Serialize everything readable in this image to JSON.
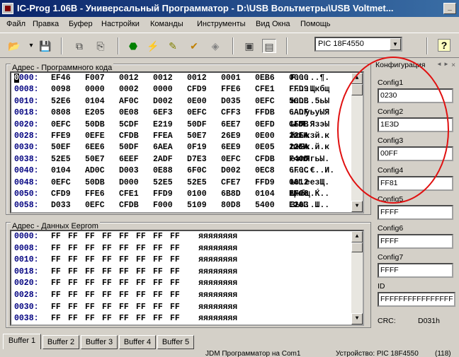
{
  "window": {
    "title": "IC-Prog 1.06B - Универсальный Программатор - D:\\USB Вольтметры\\USB Voltmet...",
    "min_glyph": "_"
  },
  "menu": [
    "Файл",
    "Правка",
    "Буфер",
    "Настройки",
    "Команды",
    "Инструменты",
    "Вид Окна",
    "Помощь"
  ],
  "toolbar": {
    "device": "PIC 18F4550",
    "dropdown_glyph": "▼"
  },
  "program_memory": {
    "title": "Адрес - Программного кода",
    "rows": [
      {
        "addr": "0000:",
        "w": [
          "EF46",
          "F007",
          "0012",
          "0012",
          "0012",
          "0001",
          "0EB6",
          "0000"
        ],
        "ascii": "F.....¶."
      },
      {
        "addr": "0008:",
        "w": [
          "0098",
          "0000",
          "0002",
          "0000",
          "CFD9",
          "FFE6",
          "CFE1",
          "FFD9"
        ],
        "ascii": "□...Щкбщ"
      },
      {
        "addr": "0010:",
        "w": [
          "52E6",
          "0104",
          "AF0C",
          "D002",
          "0E00",
          "D035",
          "0EFC",
          "50DB"
        ],
        "ascii": "ж....5ьЫ"
      },
      {
        "addr": "0018:",
        "w": [
          "0808",
          "E205",
          "0E08",
          "6EF3",
          "0EFC",
          "CFF3",
          "FFDB",
          "6ADF"
        ],
        "ascii": "...уьуЫЯ"
      },
      {
        "addr": "0020:",
        "w": [
          "0EFC",
          "50DB",
          "5CDF",
          "E219",
          "50DF",
          "6EE7",
          "0EFD",
          "CFDB"
        ],
        "ascii": "ьЫЯ.ЯзэЫ"
      },
      {
        "addr": "0028:",
        "w": [
          "FFE9",
          "0EFE",
          "CFDB",
          "FFEA",
          "50E7",
          "26E9",
          "0E00",
          "22EA"
        ],
        "ascii": "йюЫкзй.к"
      },
      {
        "addr": "0030:",
        "w": [
          "50EF",
          "6EE6",
          "50DF",
          "6AEA",
          "0F19",
          "6EE9",
          "0E05",
          "22EA"
        ],
        "ascii": "пжЯк.й.к"
      },
      {
        "addr": "0038:",
        "w": [
          "52E5",
          "50E7",
          "6EEF",
          "2ADF",
          "D7E3",
          "0EFC",
          "CFDB",
          "F40D"
        ],
        "ascii": "езпЯгьЫ."
      },
      {
        "addr": "0040:",
        "w": [
          "0104",
          "AD0C",
          "D003",
          "0E88",
          "6F0C",
          "D002",
          "0EC8",
          "6F0C"
        ],
        "ascii": "....€..И."
      },
      {
        "addr": "0048:",
        "w": [
          "0EFC",
          "50DB",
          "D000",
          "52E5",
          "52E5",
          "CFE7",
          "FFD9",
          "0012"
        ],
        "ascii": "ьЫ.eeзЩ."
      },
      {
        "addr": "0050:",
        "w": [
          "CFD9",
          "FFE6",
          "CFE1",
          "FFD9",
          "0100",
          "6B8D",
          "0104",
          "BF08"
        ],
        "ascii": "Щжбщ.Ќ.."
      },
      {
        "addr": "0058:",
        "w": [
          "D033",
          "0EFC",
          "CFDB",
          "F000",
          "5109",
          "80D8",
          "5400",
          "E203"
        ],
        "ascii": "3ьЫ..Ш.."
      }
    ]
  },
  "eeprom": {
    "title": "Адрес - Данных Eeprom",
    "rows": [
      {
        "addr": "0000:",
        "b": [
          "FF",
          "FF",
          "FF",
          "FF",
          "FF",
          "FF",
          "FF",
          "FF"
        ],
        "ascii": "яяяяяяяя"
      },
      {
        "addr": "0008:",
        "b": [
          "FF",
          "FF",
          "FF",
          "FF",
          "FF",
          "FF",
          "FF",
          "FF"
        ],
        "ascii": "яяяяяяяя"
      },
      {
        "addr": "0010:",
        "b": [
          "FF",
          "FF",
          "FF",
          "FF",
          "FF",
          "FF",
          "FF",
          "FF"
        ],
        "ascii": "яяяяяяяя"
      },
      {
        "addr": "0018:",
        "b": [
          "FF",
          "FF",
          "FF",
          "FF",
          "FF",
          "FF",
          "FF",
          "FF"
        ],
        "ascii": "яяяяяяяя"
      },
      {
        "addr": "0020:",
        "b": [
          "FF",
          "FF",
          "FF",
          "FF",
          "FF",
          "FF",
          "FF",
          "FF"
        ],
        "ascii": "яяяяяяяя"
      },
      {
        "addr": "0028:",
        "b": [
          "FF",
          "FF",
          "FF",
          "FF",
          "FF",
          "FF",
          "FF",
          "FF"
        ],
        "ascii": "яяяяяяяя"
      },
      {
        "addr": "0030:",
        "b": [
          "FF",
          "FF",
          "FF",
          "FF",
          "FF",
          "FF",
          "FF",
          "FF"
        ],
        "ascii": "яяяяяяяя"
      },
      {
        "addr": "0038:",
        "b": [
          "FF",
          "FF",
          "FF",
          "FF",
          "FF",
          "FF",
          "FF",
          "FF"
        ],
        "ascii": "яяяяяяяя"
      }
    ]
  },
  "config_panel": {
    "title": "Конфигурация",
    "nav": [
      "◄",
      "►",
      "×"
    ],
    "fields": [
      {
        "label": "Config1",
        "value": "0230"
      },
      {
        "label": "Config2",
        "value": "1E3D"
      },
      {
        "label": "Config3",
        "value": "00FF"
      },
      {
        "label": "Config4",
        "value": "FF81"
      },
      {
        "label": "Config5",
        "value": "FFFF"
      },
      {
        "label": "Config6",
        "value": "FFFF"
      },
      {
        "label": "Config7",
        "value": "FFFF"
      },
      {
        "label": "ID",
        "value": "FFFFFFFFFFFFFFFF"
      }
    ],
    "crc_label": "CRC:",
    "crc_value": "D031h"
  },
  "tabs": [
    "Buffer 1",
    "Buffer 2",
    "Buffer 3",
    "Buffer 4",
    "Buffer 5"
  ],
  "status": {
    "programmer": "JDM Программатор на Com1",
    "device": "Устройство: PIC 18F4550",
    "rev": "(118)"
  },
  "scroll_glyphs": {
    "up": "▲",
    "down": "▼"
  },
  "icons": [
    {
      "name": "open-folder-icon",
      "glyph": "📂",
      "color": "#c08000"
    },
    {
      "name": "dropdown-arrow-icon",
      "glyph": "▾",
      "color": "#000000"
    },
    {
      "name": "save-icon",
      "glyph": "💾",
      "color": "#000080"
    },
    {
      "name": "copy-buffer-icon",
      "glyph": "⧉",
      "color": "#404040"
    },
    {
      "name": "paste-buffer-icon",
      "glyph": "⎘",
      "color": "#404040"
    },
    {
      "name": "read-chip-icon",
      "glyph": "⬣",
      "color": "#008000"
    },
    {
      "name": "program-chip-icon",
      "glyph": "⚡",
      "color": "#c0a000"
    },
    {
      "name": "erase-chip-icon",
      "glyph": "✎",
      "color": "#808000"
    },
    {
      "name": "verify-chip-icon",
      "glyph": "✔",
      "color": "#c08000"
    },
    {
      "name": "blank-check-icon",
      "glyph": "◈",
      "color": "#808080"
    },
    {
      "name": "hex-view-icon",
      "glyph": "▣",
      "color": "#404040"
    },
    {
      "name": "asm-view-icon",
      "glyph": "▤",
      "color": "#404040"
    },
    {
      "name": "help-icon",
      "glyph": "?",
      "color": "#000000"
    }
  ],
  "colors": {
    "title_start": "#0a246a",
    "title_end": "#3a6ea5",
    "annotation_red": "#e01010"
  }
}
